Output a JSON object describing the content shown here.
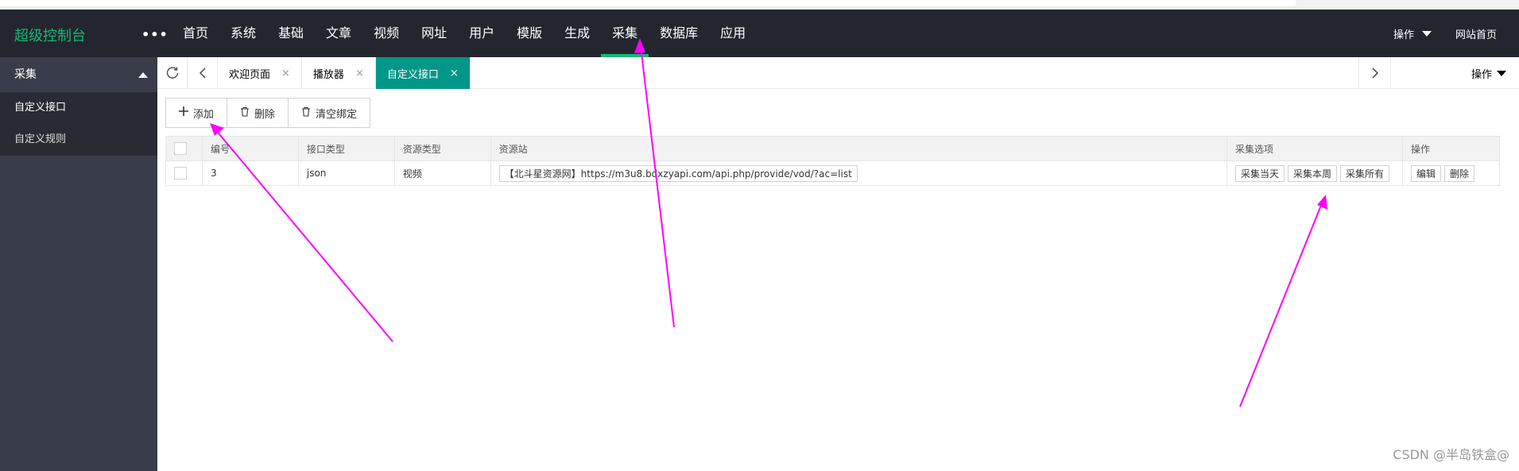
{
  "header": {
    "logo": "超级控制台",
    "more": "•••",
    "nav": [
      "首页",
      "系统",
      "基础",
      "文章",
      "视频",
      "网址",
      "用户",
      "模版",
      "生成",
      "采集",
      "数据库",
      "应用"
    ],
    "active_nav": "采集",
    "operate_label": "操作",
    "site_home_label": "网站首页"
  },
  "sidebar": {
    "section_title": "采集",
    "items": [
      "自定义接口",
      "自定义规则"
    ]
  },
  "tabbar": {
    "tabs": [
      "欢迎页面",
      "播放器",
      "自定义接口"
    ],
    "active_tab": "自定义接口",
    "close_glyph": "×",
    "ops_label": "操作"
  },
  "toolbar": {
    "add": "添加",
    "delete": "删除",
    "clear_binding": "清空绑定"
  },
  "table": {
    "headers": [
      "编号",
      "接口类型",
      "资源类型",
      "资源站",
      "采集选项",
      "操作"
    ],
    "rows": [
      {
        "id": "3",
        "interface_type": "json",
        "resource_type": "视频",
        "resource_site": "【北斗星资源网】https://m3u8.bdxzyapi.com/api.php/provide/vod/?ac=list",
        "collect_options": [
          "采集当天",
          "采集本周",
          "采集所有"
        ],
        "actions": [
          "编辑",
          "删除"
        ]
      }
    ]
  },
  "watermark": "CSDN @半岛铁盒@",
  "annotation_color": "#ff00ff"
}
